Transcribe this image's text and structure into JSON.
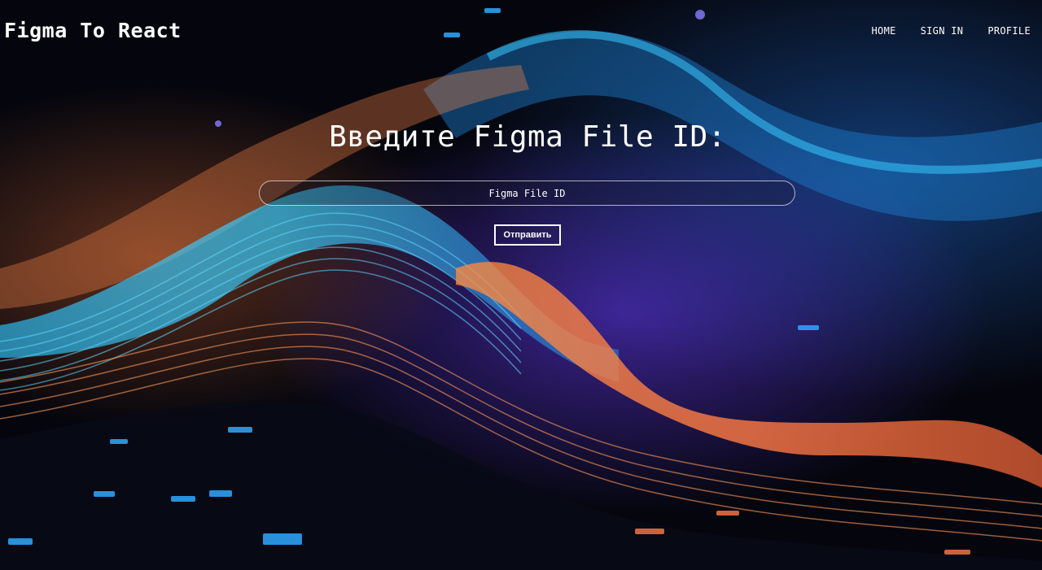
{
  "header": {
    "logo": "Figma To React",
    "nav": {
      "home": "HOME",
      "sign_in": "SIGN IN",
      "profile": "PROFILE"
    }
  },
  "main": {
    "heading": "Введите Figma File ID:",
    "input": {
      "placeholder": "Figma File ID",
      "value": ""
    },
    "submit_label": "Отправить"
  },
  "background": {
    "image": "abstract-wave-artwork",
    "colors": {
      "base": "#05060d",
      "cyan": "#2fc6ff",
      "orange": "#ff8a3d",
      "purple": "#6a3cff"
    }
  }
}
